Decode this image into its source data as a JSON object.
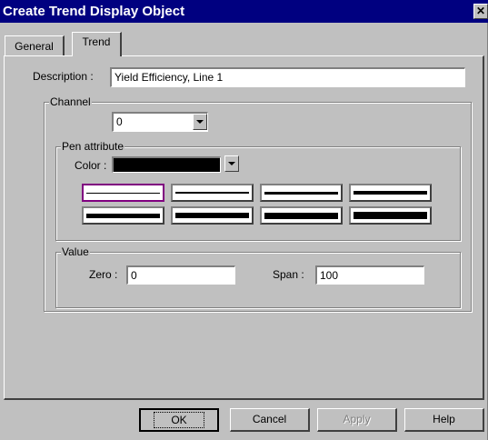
{
  "window": {
    "title": "Create Trend Display  Object",
    "close_glyph": "✕"
  },
  "tabs": [
    {
      "label": "General",
      "active": false
    },
    {
      "label": "Trend",
      "active": true
    }
  ],
  "description": {
    "label": "Description :",
    "value": "Yield Efficiency, Line 1"
  },
  "channel": {
    "title": "Channel",
    "selected": "0"
  },
  "pen_attribute": {
    "title": "Pen attribute",
    "color_label": "Color :",
    "color_value": "#000000",
    "pen_styles": [
      {
        "thickness": 1,
        "lines": 1
      },
      {
        "thickness": 2,
        "lines": 1
      },
      {
        "thickness": 3,
        "lines": 1
      },
      {
        "thickness": 4,
        "lines": 1
      },
      {
        "thickness": 5,
        "lines": 1
      },
      {
        "thickness": 6,
        "lines": 1
      },
      {
        "thickness": 7,
        "lines": 1
      },
      {
        "thickness": 8,
        "lines": 1
      }
    ],
    "selected_index": 0,
    "selection_color": "#800080"
  },
  "value": {
    "title": "Value",
    "zero_label": "Zero :",
    "zero_value": "0",
    "span_label": "Span :",
    "span_value": "100"
  },
  "buttons": {
    "ok": "OK",
    "cancel": "Cancel",
    "apply": "Apply",
    "help": "Help"
  },
  "colors": {
    "title_bar": "#000080",
    "face": "#c0c0c0"
  }
}
